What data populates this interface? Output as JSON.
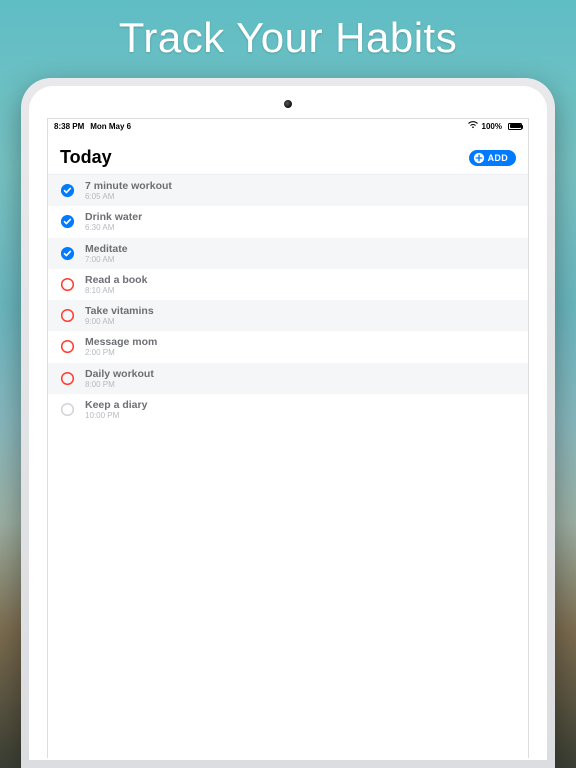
{
  "marketing": {
    "headline": "Track Your Habits"
  },
  "statusbar": {
    "time": "8:38 PM",
    "date": "Mon May 6",
    "battery_pct": "100%"
  },
  "header": {
    "title": "Today",
    "add_label": "ADD"
  },
  "habits": [
    {
      "title": "7 minute workout",
      "time": "6:05 AM",
      "state": "done"
    },
    {
      "title": "Drink water",
      "time": "6:30 AM",
      "state": "done"
    },
    {
      "title": "Meditate",
      "time": "7:00 AM",
      "state": "done"
    },
    {
      "title": "Read a book",
      "time": "8:10 AM",
      "state": "pending"
    },
    {
      "title": "Take vitamins",
      "time": "9:00 AM",
      "state": "pending"
    },
    {
      "title": "Message mom",
      "time": "2:00 PM",
      "state": "pending"
    },
    {
      "title": "Daily workout",
      "time": "8:00 PM",
      "state": "pending"
    },
    {
      "title": "Keep a diary",
      "time": "10:00 PM",
      "state": "inactive"
    }
  ],
  "colors": {
    "accent_blue": "#007aff",
    "pending_red": "#ff3b30",
    "inactive_grey": "#d0d3d8"
  }
}
